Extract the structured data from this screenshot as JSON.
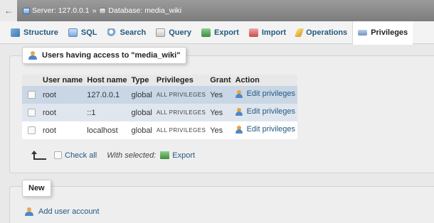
{
  "breadcrumb": {
    "back_glyph": "←",
    "server_label": "Server: 127.0.0.1",
    "separator": "»",
    "database_label": "Database: media_wiki"
  },
  "tabs": [
    {
      "label": "Structure",
      "icon": "structure-icon",
      "active": false
    },
    {
      "label": "SQL",
      "icon": "sql-icon",
      "active": false
    },
    {
      "label": "Search",
      "icon": "search-icon",
      "active": false
    },
    {
      "label": "Query",
      "icon": "query-icon",
      "active": false
    },
    {
      "label": "Export",
      "icon": "export-icon",
      "active": false
    },
    {
      "label": "Import",
      "icon": "import-icon",
      "active": false
    },
    {
      "label": "Operations",
      "icon": "operations-icon",
      "active": false
    },
    {
      "label": "Privileges",
      "icon": "privileges-icon",
      "active": true
    }
  ],
  "users_section": {
    "legend_prefix": "Users having access to ",
    "legend_db": "\"media_wiki\"",
    "columns": [
      "User name",
      "Host name",
      "Type",
      "Privileges",
      "Grant",
      "Action"
    ],
    "rows": [
      {
        "user": "root",
        "host": "127.0.0.1",
        "type": "global",
        "privileges": "ALL PRIVILEGES",
        "grant": "Yes",
        "action": "Edit privileges"
      },
      {
        "user": "root",
        "host": "::1",
        "type": "global",
        "privileges": "ALL PRIVILEGES",
        "grant": "Yes",
        "action": "Edit privileges"
      },
      {
        "user": "root",
        "host": "localhost",
        "type": "global",
        "privileges": "ALL PRIVILEGES",
        "grant": "Yes",
        "action": "Edit privileges"
      }
    ],
    "check_all_label": "Check all",
    "with_selected_label": "With selected:",
    "export_label": "Export"
  },
  "new_section": {
    "legend": "New",
    "add_user_label": "Add user account"
  },
  "colors": {
    "link": "#235a81",
    "breadcrumb_bg": "#8a8a8a",
    "selected_row": "#c9d6e5"
  }
}
